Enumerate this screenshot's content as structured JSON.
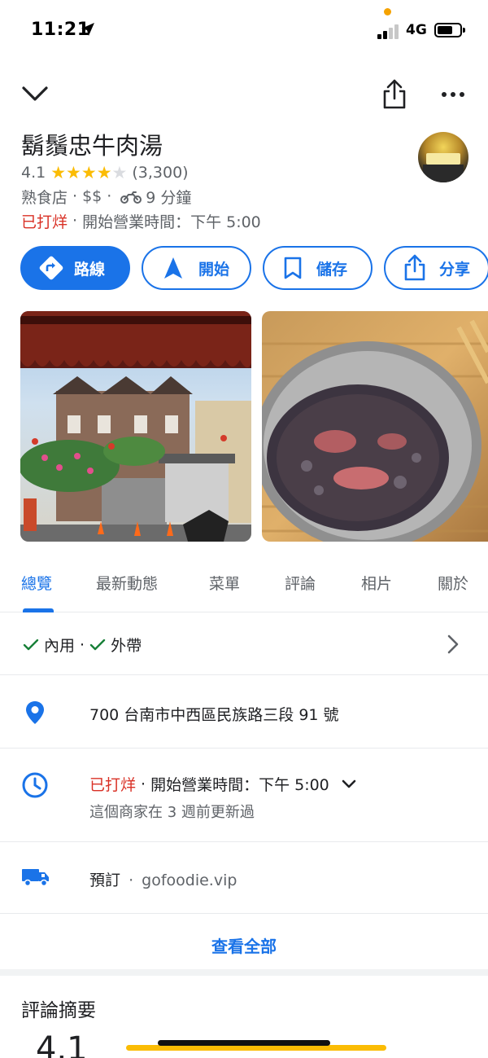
{
  "status": {
    "time": "11:21",
    "network": "4G"
  },
  "place": {
    "name": "鬍鬚忠牛肉湯",
    "rating": "4.1",
    "rating_value": 4.1,
    "review_count": "(3,300)",
    "category": "熟食店",
    "sep": "·",
    "price": "$$",
    "travel_time": "9 分鐘",
    "status": "已打烊",
    "opening": "開始營業時間：下午 5:00"
  },
  "actions": {
    "directions": "路線",
    "start": "開始",
    "save": "儲存",
    "share": "分享"
  },
  "tabs": [
    "總覽",
    "最新動態",
    "菜單",
    "評論",
    "相片",
    "關於"
  ],
  "services": {
    "dine_in": "內用",
    "takeout": "外帶",
    "sep": "·"
  },
  "address": "700 台南市中西區民族路三段 91 號",
  "hours": {
    "status": "已打烊",
    "sep": "·",
    "opening": "開始營業時間：下午 5:00",
    "updated": "這個商家在 3 週前更新過"
  },
  "order": {
    "label": "預訂",
    "sep": "·",
    "site": "gofoodie.vip"
  },
  "see_all": "查看全部",
  "review_summary": {
    "title": "評論摘要",
    "score": "4.1"
  },
  "colors": {
    "accent": "#1a73e8",
    "closed": "#d93025",
    "star": "#fbbc04",
    "check": "#188038"
  },
  "icons": [
    "location-arrow-icon",
    "chevron-down-icon",
    "share-icon",
    "more-icon",
    "star-icon",
    "motorcycle-icon",
    "directions-icon",
    "navigation-icon",
    "bookmark-icon",
    "check-icon",
    "chevron-right-icon",
    "location-pin-icon",
    "clock-icon",
    "truck-icon"
  ]
}
